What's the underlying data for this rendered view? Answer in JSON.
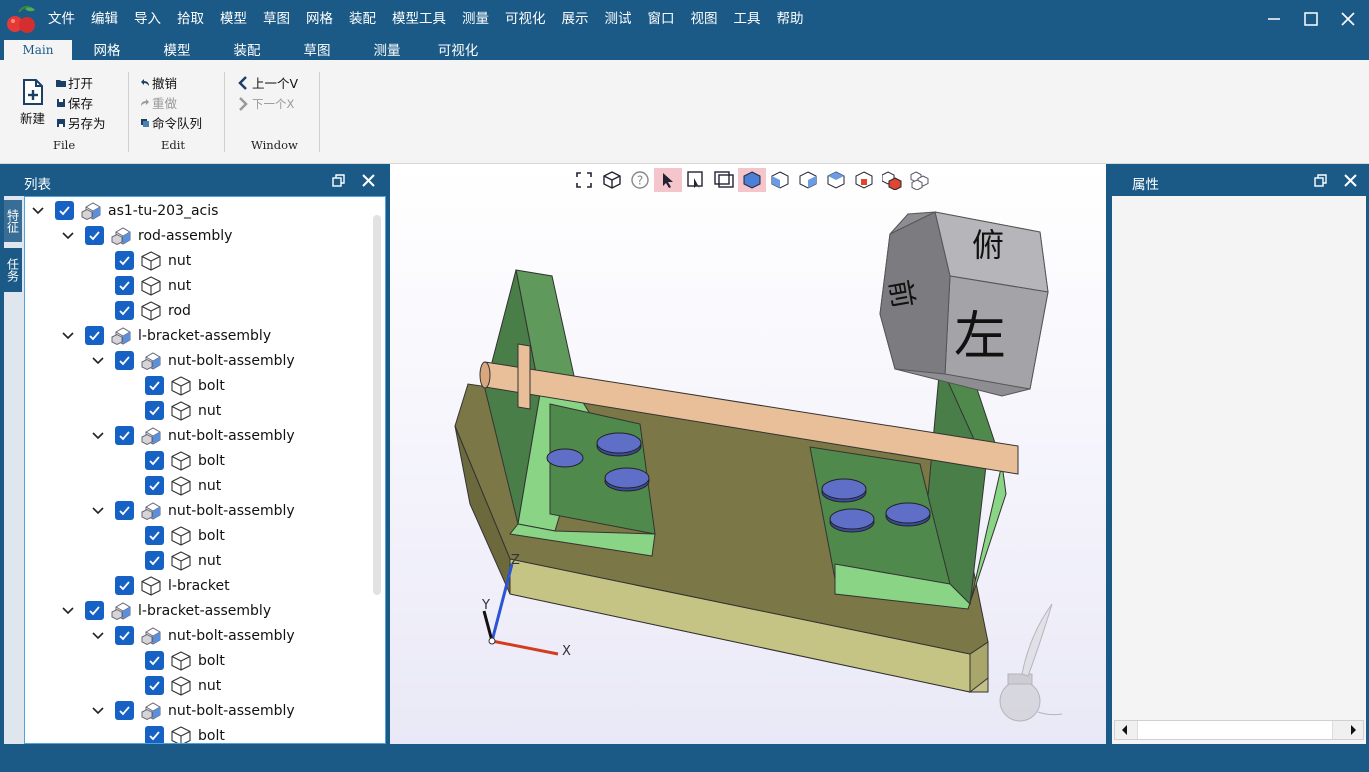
{
  "menu": [
    "文件",
    "编辑",
    "导入",
    "拾取",
    "模型",
    "草图",
    "网格",
    "装配",
    "模型工具",
    "测量",
    "可视化",
    "展示",
    "测试",
    "窗口",
    "视图",
    "工具",
    "帮助"
  ],
  "tabs": [
    "Main",
    "网格",
    "模型",
    "装配",
    "草图",
    "测量",
    "可视化"
  ],
  "ribbon": {
    "file": {
      "new": "新建",
      "open": "打开",
      "save": "保存",
      "save_as": "另存为",
      "label": "File"
    },
    "edit": {
      "undo": "撤销",
      "redo": "重做",
      "queue": "命令队列",
      "label": "Edit"
    },
    "window": {
      "prev": "上一个V",
      "next": "下一个X",
      "label": "Window"
    }
  },
  "left_panel": {
    "title": "列表",
    "side_tabs": [
      "特征",
      "任务"
    ],
    "tree": [
      {
        "label": "as1-tu-203_acis",
        "level": 0,
        "expandable": true,
        "icon": "assembly-icon"
      },
      {
        "label": "rod-assembly",
        "level": 1,
        "expandable": true,
        "icon": "assembly-icon"
      },
      {
        "label": "nut",
        "level": 2,
        "expandable": false,
        "icon": "part-icon"
      },
      {
        "label": "nut",
        "level": 2,
        "expandable": false,
        "icon": "part-icon"
      },
      {
        "label": "rod",
        "level": 2,
        "expandable": false,
        "icon": "part-icon"
      },
      {
        "label": "l-bracket-assembly",
        "level": 1,
        "expandable": true,
        "icon": "assembly-icon"
      },
      {
        "label": "nut-bolt-assembly",
        "level": 2,
        "expandable": true,
        "icon": "assembly-icon"
      },
      {
        "label": "bolt",
        "level": 3,
        "expandable": false,
        "icon": "part-icon"
      },
      {
        "label": "nut",
        "level": 3,
        "expandable": false,
        "icon": "part-icon"
      },
      {
        "label": "nut-bolt-assembly",
        "level": 2,
        "expandable": true,
        "icon": "assembly-icon"
      },
      {
        "label": "bolt",
        "level": 3,
        "expandable": false,
        "icon": "part-icon"
      },
      {
        "label": "nut",
        "level": 3,
        "expandable": false,
        "icon": "part-icon"
      },
      {
        "label": "nut-bolt-assembly",
        "level": 2,
        "expandable": true,
        "icon": "assembly-icon"
      },
      {
        "label": "bolt",
        "level": 3,
        "expandable": false,
        "icon": "part-icon"
      },
      {
        "label": "nut",
        "level": 3,
        "expandable": false,
        "icon": "part-icon"
      },
      {
        "label": "l-bracket",
        "level": 2,
        "expandable": false,
        "icon": "part-icon"
      },
      {
        "label": "l-bracket-assembly",
        "level": 1,
        "expandable": true,
        "icon": "assembly-icon"
      },
      {
        "label": "nut-bolt-assembly",
        "level": 2,
        "expandable": true,
        "icon": "assembly-icon"
      },
      {
        "label": "bolt",
        "level": 3,
        "expandable": false,
        "icon": "part-icon"
      },
      {
        "label": "nut",
        "level": 3,
        "expandable": false,
        "icon": "part-icon"
      },
      {
        "label": "nut-bolt-assembly",
        "level": 2,
        "expandable": true,
        "icon": "assembly-icon"
      },
      {
        "label": "bolt",
        "level": 3,
        "expandable": false,
        "icon": "part-icon"
      }
    ]
  },
  "viewport": {
    "view_cube": {
      "top": "俯",
      "front": "左",
      "side": "前"
    },
    "axes": {
      "x": "X",
      "y": "Y",
      "z": "Z"
    }
  },
  "right_panel": {
    "title": "属性"
  },
  "colors": {
    "brand": "#1b5a87",
    "checkbox": "#1661c4",
    "tree_border": "#4da2e0"
  }
}
